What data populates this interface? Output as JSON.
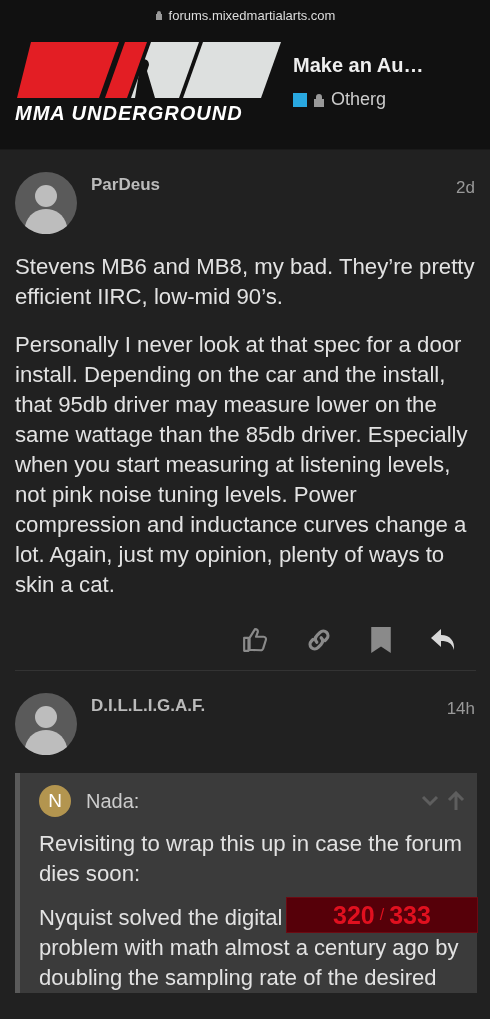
{
  "browser": {
    "url": "forums.mixedmartialarts.com"
  },
  "header": {
    "logo_text": "MMA UNDERGROUND",
    "topic_title": "Make an Au…",
    "category": {
      "name": "Otherg",
      "color": "#29a8e0",
      "locked": true
    }
  },
  "posts": [
    {
      "author": "ParDeus",
      "age": "2d",
      "paragraphs": [
        "Stevens MB6 and MB8, my bad. They’re pretty efficient IIRC, low-mid 90’s.",
        "Personally I never look at that spec for a door install. Depending on the car and the install, that 95db driver may measure lower on the same wattage than the 85db driver. Especially when you start measuring at listening levels, not pink noise tuning levels. Power compression and inductance curves change a lot. Again, just my opinion, plenty of ways to skin a cat."
      ],
      "has_actions": true
    },
    {
      "author": "D.I.L.L.I.G.A.F.",
      "age": "14h",
      "quote": {
        "initial": "N",
        "author": "Nada:",
        "paragraphs": [
          "Revisiting to wrap this up in case the forum dies soon:"
        ],
        "lines": [
          "Nyquist solved the digital",
          "problem with math almost a century ago by",
          "doubling the sampling rate of the desired"
        ]
      }
    }
  ],
  "progress": {
    "current": "320",
    "separator": "/",
    "total": "333"
  }
}
